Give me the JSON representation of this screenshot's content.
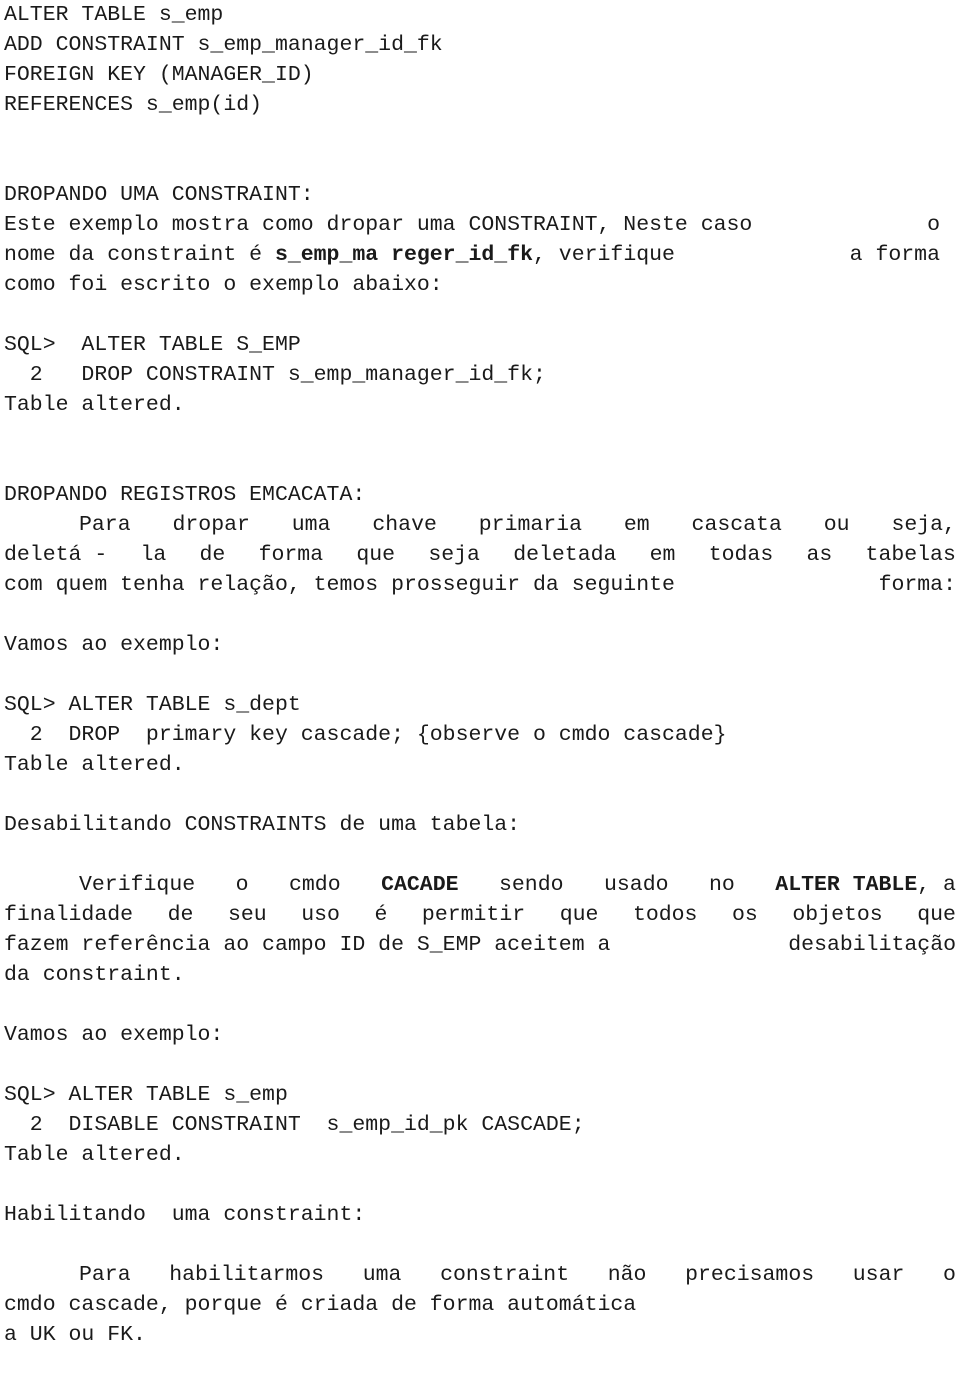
{
  "document": {
    "blocks": [
      {
        "id": "sql_fk_definition",
        "lines": [
          "ALTER TABLE s_emp",
          "ADD CONSTRAINT s_emp_manager_id_fk",
          "FOREIGN KEY (MANAGER_ID)",
          "REFERENCES s_emp(id)"
        ]
      },
      {
        "id": "heading_dropando_constraint",
        "text": "DROPANDO UMA CONSTRAINT:"
      },
      {
        "id": "para_dropando_constraint",
        "line1_a": "Este exemplo mostra como dropar uma CONSTRAINT, Neste caso",
        "line1_b": "o",
        "line2_a": "nome da constraint é ",
        "line2_bold": "s_emp_ma reger_id_fk",
        "line2_b": ", verifique",
        "line2_c": "a forma",
        "line3": "como foi escrito o exemplo abaixo:"
      },
      {
        "id": "sql_drop_constraint",
        "lines": [
          "SQL>  ALTER TABLE S_EMP",
          "  2   DROP CONSTRAINT s_emp_manager_id_fk;"
        ]
      },
      {
        "id": "result_table_altered_1",
        "text": "Table altered."
      },
      {
        "id": "heading_dropando_registros",
        "text": "DROPANDO REGISTROS EMCACATA:"
      },
      {
        "id": "para_dropando_registros",
        "line1_a": "Para",
        "line1_b": "dropar",
        "line1_c": "uma",
        "line1_d": "chave",
        "line1_e": "primaria",
        "line1_f": "em",
        "line1_g": "cascata",
        "line1_h": "ou",
        "line1_i": "seja,",
        "line2_a": "deletá -",
        "line2_b": "la",
        "line2_c": "de",
        "line2_d": "forma",
        "line2_e": "que",
        "line2_f": "seja",
        "line2_g": "deletada",
        "line2_h": "em",
        "line2_i": "todas",
        "line2_j": "as",
        "line2_k": "tabelas",
        "line3_a": "com quem tenha relação, temos prosseguir da seguinte",
        "line3_b": "forma:"
      },
      {
        "id": "lead_vamos_exemplo_1",
        "text": "Vamos ao exemplo:"
      },
      {
        "id": "sql_drop_primary_key_cascade",
        "lines": [
          "SQL> ALTER TABLE s_dept",
          "  2  DROP  primary key cascade; {observe o cmdo cascade}"
        ]
      },
      {
        "id": "result_table_altered_2",
        "text": "Table altered."
      },
      {
        "id": "heading_desabilitando",
        "text": "Desabilitando CONSTRAINTS de uma tabela:"
      },
      {
        "id": "para_desabilitando",
        "line1_a": "Verifique",
        "line1_b": "o",
        "line1_c": "cmdo",
        "line1_bold1": "CACADE",
        "line1_d": "sendo",
        "line1_e": "usado",
        "line1_f": "no",
        "line1_bold2": "ALTER TABLE",
        "line1_g": ", a",
        "line2_a": "finalidade",
        "line2_b": "de",
        "line2_c": "seu",
        "line2_d": "uso",
        "line2_e": "é",
        "line2_f": "permitir",
        "line2_g": "que",
        "line2_h": "todos",
        "line2_i": "os",
        "line2_j": "objetos",
        "line2_k": "que",
        "line3_a": "fazem referência ao campo ID de S_EMP aceitem a",
        "line3_b": "desabilitação",
        "line4": "da constraint."
      },
      {
        "id": "lead_vamos_exemplo_2",
        "text": "Vamos ao exemplo:"
      },
      {
        "id": "sql_disable_constraint",
        "lines": [
          "SQL> ALTER TABLE s_emp",
          "  2  DISABLE CONSTRAINT  s_emp_id_pk CASCADE;"
        ]
      },
      {
        "id": "result_table_altered_3",
        "text": "Table altered."
      },
      {
        "id": "heading_habilitando",
        "text": "Habilitando  uma constraint:"
      },
      {
        "id": "para_habilitando",
        "line1_a": "Para",
        "line1_b": "habilitarmos",
        "line1_c": "uma",
        "line1_d": "constraint",
        "line1_e": "não",
        "line1_f": "precisamos",
        "line1_g": "usar",
        "line1_h": "o",
        "line2": "cmdo cascade, porque é criada de forma automática",
        "line3": "a UK ou FK."
      }
    ]
  }
}
